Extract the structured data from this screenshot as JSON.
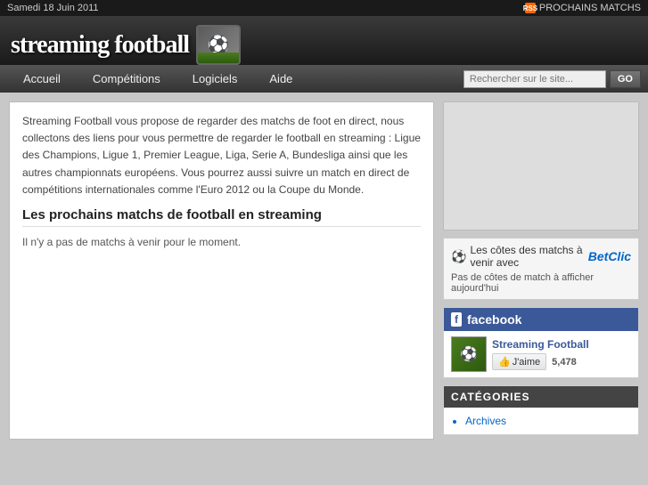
{
  "topbar": {
    "date": "Samedi 18 Juin 2011",
    "rss_label": "PROCHAINS MATCHS"
  },
  "header": {
    "logo_text": "streaming football",
    "logo_icon": "⚽"
  },
  "nav": {
    "items": [
      {
        "label": "Accueil",
        "id": "accueil"
      },
      {
        "label": "Compétitions",
        "id": "competitions"
      },
      {
        "label": "Logiciels",
        "id": "logiciels"
      },
      {
        "label": "Aide",
        "id": "aide"
      }
    ],
    "search_placeholder": "Rechercher sur le site...",
    "search_button": "GO"
  },
  "content": {
    "intro_text": "Streaming Football vous propose de regarder des matchs de foot en direct, nous collectons des liens pour vous permettre de regarder le football en streaming : Ligue des Champions, Ligue 1, Premier League, Liga, Serie A, Bundesliga ainsi que les autres championnats européens. Vous pourrez aussi suivre un match en direct de compétitions internationales comme l'Euro 2012 ou la Coupe du Monde.",
    "section_title": "Les prochains matchs de football en streaming",
    "no_matches": "Il n'y a pas de matchs à venir pour le moment."
  },
  "sidebar": {
    "betclic": {
      "header_text": "Les côtes des matchs à venir avec",
      "brand": "BetClic",
      "info_text": "Pas de côtes de match à afficher aujourd'hui"
    },
    "facebook": {
      "header_label": "facebook",
      "fb_logo_text": "f",
      "page_name": "Streaming Football",
      "like_label": "J'aime",
      "count": "5,478"
    },
    "categories": {
      "header": "CATÉGORIES",
      "items": [
        "Archives"
      ]
    }
  }
}
